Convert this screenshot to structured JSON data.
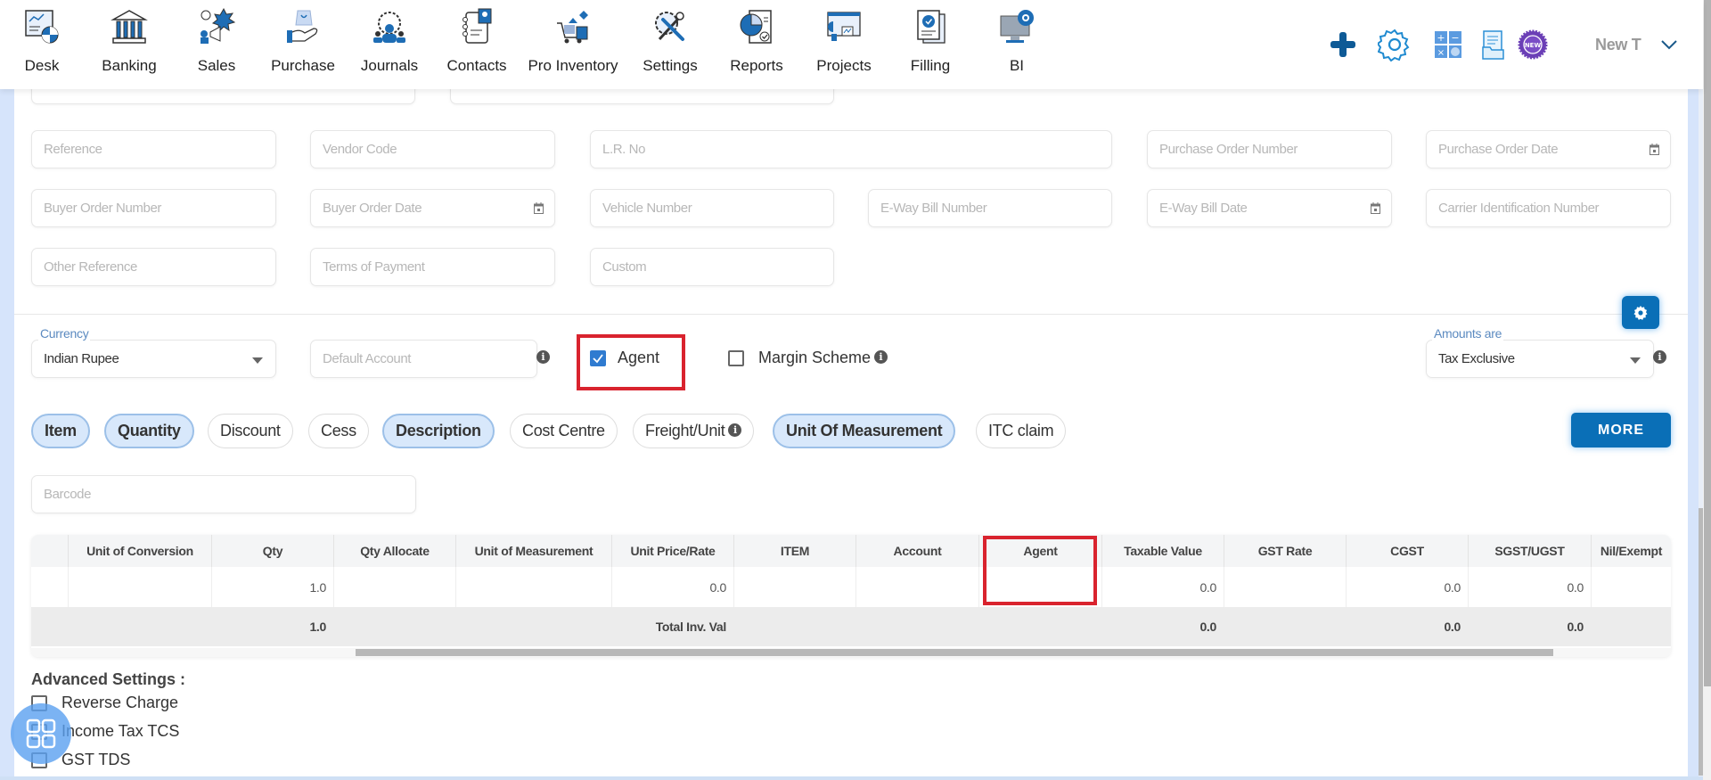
{
  "nav": {
    "items": [
      {
        "label": "Desk",
        "icon": "desk-dashboard-icon"
      },
      {
        "label": "Banking",
        "icon": "bank-building-icon"
      },
      {
        "label": "Sales",
        "icon": "sales-megaphone-icon"
      },
      {
        "label": "Purchase",
        "icon": "purchase-hand-bag-icon"
      },
      {
        "label": "Journals",
        "icon": "journals-team-gear-icon"
      },
      {
        "label": "Contacts",
        "icon": "contacts-notebook-icon"
      },
      {
        "label": "Pro Inventory",
        "icon": "inventory-cart-icon"
      },
      {
        "label": "Settings",
        "icon": "settings-tools-icon"
      },
      {
        "label": "Reports",
        "icon": "reports-pie-chart-icon"
      },
      {
        "label": "Projects",
        "icon": "projects-monitor-icon"
      },
      {
        "label": "Filling",
        "icon": "filling-document-check-icon"
      },
      {
        "label": "BI",
        "icon": "bi-monitor-gear-icon"
      }
    ],
    "right_icons": [
      "plus-icon",
      "gear-icon",
      "calculator-icon",
      "document-folder-icon",
      "new-badge-icon"
    ],
    "user_label": "New T",
    "user_chevron": "chevron-down-icon"
  },
  "form": {
    "row1": [
      {
        "placeholder": "Reference",
        "name": "reference-input"
      },
      {
        "placeholder": "Vendor Code",
        "name": "vendor-code-input"
      },
      {
        "placeholder": "L.R. No",
        "name": "lr-no-input"
      },
      {
        "placeholder": "Purchase Order Number",
        "name": "purchase-order-number-input"
      },
      {
        "placeholder": "Purchase Order Date",
        "name": "purchase-order-date-input",
        "calendar": true
      }
    ],
    "row2": [
      {
        "placeholder": "Buyer Order Number",
        "name": "buyer-order-number-input"
      },
      {
        "placeholder": "Buyer Order Date",
        "name": "buyer-order-date-input",
        "calendar": true
      },
      {
        "placeholder": "Vehicle Number",
        "name": "vehicle-number-input"
      },
      {
        "placeholder": "E-Way Bill Number",
        "name": "eway-bill-number-input"
      },
      {
        "placeholder": "E-Way Bill Date",
        "name": "eway-bill-date-input",
        "calendar": true
      },
      {
        "placeholder": "Carrier Identification Number",
        "name": "carrier-id-input"
      }
    ],
    "row3": [
      {
        "placeholder": "Other Reference",
        "name": "other-reference-input"
      },
      {
        "placeholder": "Terms of Payment",
        "name": "terms-of-payment-input"
      },
      {
        "placeholder": "Custom",
        "name": "custom-input"
      }
    ]
  },
  "options": {
    "currency_label": "Currency",
    "currency_value": "Indian Rupee",
    "default_account_placeholder": "Default Account",
    "agent_label": "Agent",
    "agent_checked": true,
    "margin_scheme_label": "Margin Scheme",
    "margin_scheme_checked": false,
    "amounts_label": "Amounts are",
    "amounts_value": "Tax Exclusive",
    "info_glyph": "i"
  },
  "chips": [
    {
      "label": "Item",
      "active": true
    },
    {
      "label": "Quantity",
      "active": true
    },
    {
      "label": "Discount",
      "active": false
    },
    {
      "label": "Cess",
      "active": false
    },
    {
      "label": "Description",
      "active": true
    },
    {
      "label": "Cost Centre",
      "active": false
    },
    {
      "label": "Freight/Unit",
      "active": false,
      "info": true
    },
    {
      "label": "Unit Of Measurement",
      "active": true
    },
    {
      "label": "ITC claim",
      "active": false
    }
  ],
  "more_label": "MORE",
  "barcode_placeholder": "Barcode",
  "table": {
    "columns": [
      "",
      "Unit of Conversion",
      "Qty",
      "Qty Allocate",
      "Unit of Measurement",
      "Unit Price/Rate",
      "ITEM",
      "Account",
      "Agent",
      "Taxable Value",
      "GST Rate",
      "CGST",
      "SGST/UGST",
      "Nil/Exempt"
    ],
    "row": [
      "",
      "",
      "1.0",
      "",
      "",
      "0.0",
      "",
      "",
      "",
      "0.0",
      "",
      "0.0",
      "0.0",
      ""
    ],
    "total": [
      "",
      "",
      "1.0",
      "",
      "",
      "Total Inv. Val",
      "",
      "",
      "",
      "0.0",
      "",
      "0.0",
      "0.0",
      ""
    ]
  },
  "advanced": {
    "title": "Advanced Settings :",
    "items": [
      {
        "label": "Reverse Charge",
        "checked": false
      },
      {
        "label": "Income Tax TCS",
        "checked": false
      },
      {
        "label": "GST TDS",
        "checked": false
      }
    ]
  }
}
